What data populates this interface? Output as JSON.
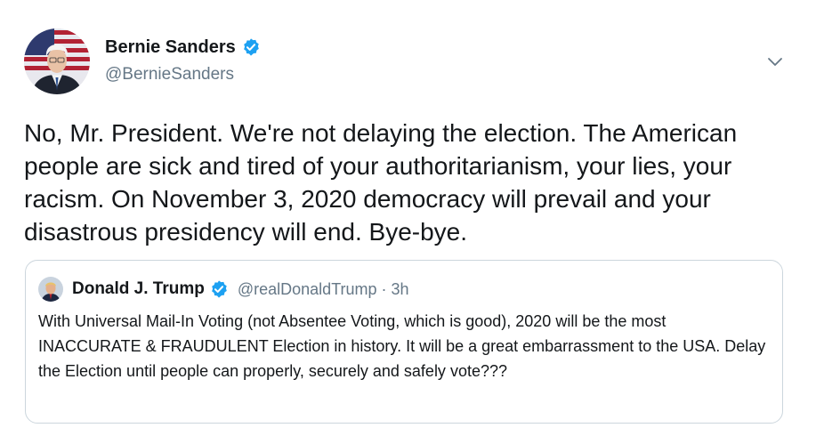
{
  "tweet": {
    "author_name": "Bernie Sanders",
    "author_handle": "@BernieSanders",
    "verified": true,
    "text": "No, Mr. President. We're not delaying the election. The American people are sick and tired of your authoritarianism, your lies, your racism. On November 3, 2020 democracy will prevail and your disastrous presidency will end. Bye-bye.",
    "menu_icon": "chevron-down-icon"
  },
  "quoted_tweet": {
    "author_name": "Donald J. Trump",
    "verified": true,
    "handle_and_time": "@realDonaldTrump · 3h",
    "text": "With Universal Mail-In Voting (not Absentee Voting, which is good), 2020 will be the most INACCURATE & FRAUDULENT Election in history. It will be a great embarrassment to the USA. Delay the Election until people can properly, securely and safely vote???"
  },
  "colors": {
    "verified_blue": "#1da1f2",
    "text_primary": "#14171a",
    "text_secondary": "#657786",
    "border": "#ccd6dd"
  }
}
